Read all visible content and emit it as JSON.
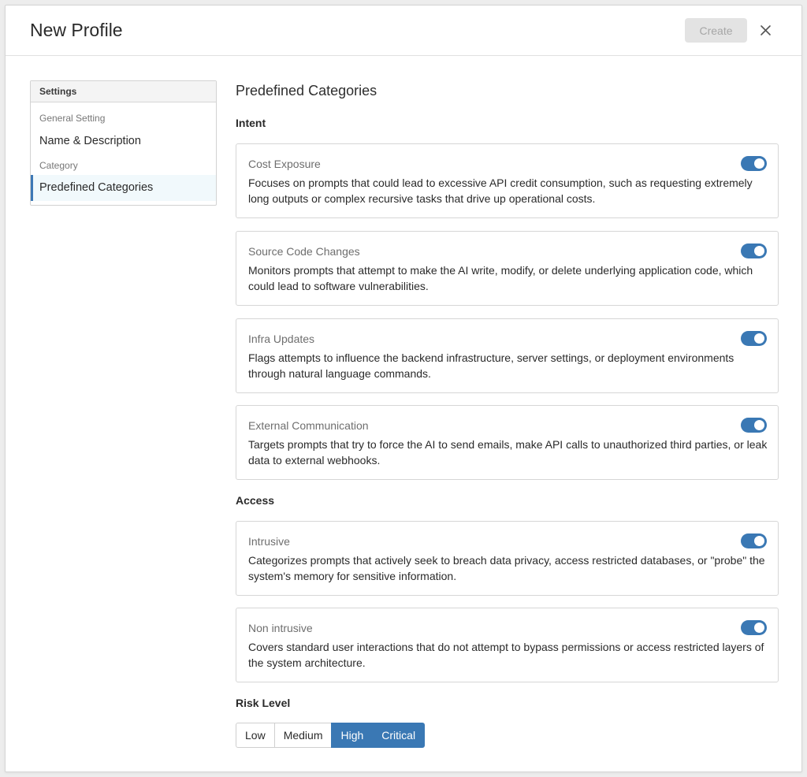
{
  "header": {
    "title": "New Profile",
    "create_label": "Create",
    "close_icon": "close-icon"
  },
  "sidebar": {
    "heading": "Settings",
    "groups": [
      {
        "label": "General Setting",
        "items": [
          {
            "label": "Name & Description",
            "active": false
          }
        ]
      },
      {
        "label": "Category",
        "items": [
          {
            "label": "Predefined Categories",
            "active": true
          }
        ]
      }
    ]
  },
  "main": {
    "title": "Predefined Categories",
    "sections": [
      {
        "label": "Intent",
        "cards": [
          {
            "title": "Cost Exposure",
            "description": "Focuses on prompts that could lead to excessive API credit consumption, such as requesting extremely long outputs or complex recursive tasks that drive up operational costs.",
            "enabled": true
          },
          {
            "title": "Source Code Changes",
            "description": "Monitors prompts that attempt to make the AI write, modify, or delete underlying application code, which could lead to software vulnerabilities.",
            "enabled": true
          },
          {
            "title": "Infra Updates",
            "description": "Flags attempts to influence the backend infrastructure, server settings, or deployment environments through natural language commands.",
            "enabled": true
          },
          {
            "title": "External Communication",
            "description": "Targets prompts that try to force the AI to send emails, make API calls to unauthorized third parties, or leak data to external webhooks.",
            "enabled": true
          }
        ]
      },
      {
        "label": "Access",
        "cards": [
          {
            "title": "Intrusive",
            "description": "Categorizes prompts that actively seek to breach data privacy, access restricted databases, or \"probe\" the system's memory for sensitive information.",
            "enabled": true
          },
          {
            "title": "Non intrusive",
            "description": "Covers standard user interactions that do not attempt to bypass permissions or access restricted layers of the system architecture.",
            "enabled": true
          }
        ]
      }
    ],
    "risk_level": {
      "label": "Risk Level",
      "options": [
        {
          "label": "Low",
          "selected": false
        },
        {
          "label": "Medium",
          "selected": false
        },
        {
          "label": "High",
          "selected": true
        },
        {
          "label": "Critical",
          "selected": true
        }
      ]
    }
  },
  "colors": {
    "accent": "#3a78b4",
    "active_item_bg": "#f1f9fc",
    "disabled_button_bg": "#e3e3e3"
  }
}
